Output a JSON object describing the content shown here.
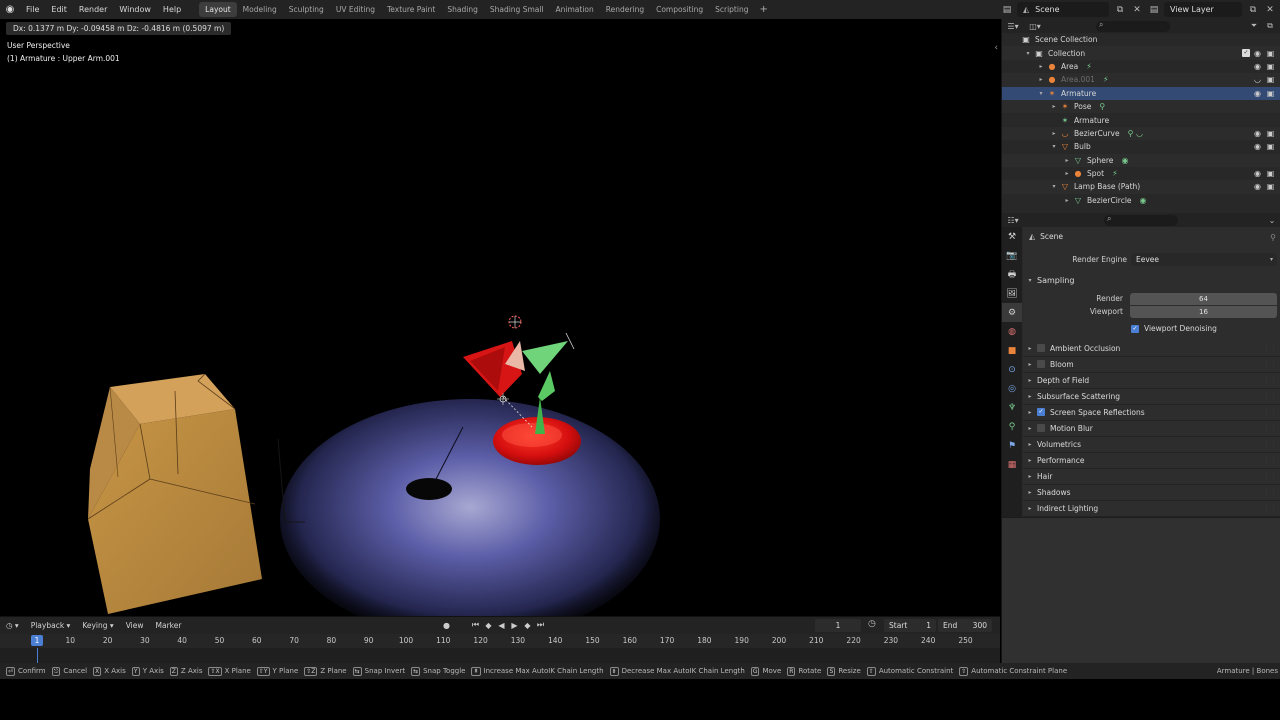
{
  "topbar": {
    "menus": [
      "File",
      "Edit",
      "Render",
      "Window",
      "Help"
    ],
    "workspaces": [
      "Layout",
      "Modeling",
      "Sculpting",
      "UV Editing",
      "Texture Paint",
      "Shading",
      "Shading Small",
      "Animation",
      "Rendering",
      "Compositing",
      "Scripting"
    ],
    "active_workspace": "Layout",
    "add": "+",
    "scene": "Scene",
    "view_layer": "View Layer"
  },
  "viewport": {
    "header_text": "Dx: 0.1377 m  Dy: -0.09458 m  Dz: -0.4816 m (0.5097 m)",
    "view_name": "User Perspective",
    "active_object": "(1) Armature : Upper Arm.001"
  },
  "timeline": {
    "menus": [
      "Playback",
      "Keying",
      "View",
      "Marker"
    ],
    "current_frame": "1",
    "start_label": "Start",
    "start_value": "1",
    "end_label": "End",
    "end_value": "300",
    "ruler": [
      "10",
      "20",
      "30",
      "40",
      "50",
      "60",
      "70",
      "80",
      "90",
      "100",
      "110",
      "120",
      "130",
      "140",
      "150",
      "160",
      "170",
      "180",
      "190",
      "200",
      "210",
      "220",
      "230",
      "240",
      "250"
    ],
    "cursor": "1"
  },
  "statusbar": {
    "items": [
      {
        "key": "⏎",
        "label": "Confirm"
      },
      {
        "key": "⎋",
        "label": "Cancel"
      },
      {
        "key": "X",
        "label": "X Axis"
      },
      {
        "key": "Y",
        "label": "Y Axis"
      },
      {
        "key": "Z",
        "label": "Z Axis"
      },
      {
        "key": "⇧X",
        "label": "X Plane"
      },
      {
        "key": "⇧Y",
        "label": "Y Plane"
      },
      {
        "key": "⇧Z",
        "label": "Z Plane"
      },
      {
        "key": "⇆",
        "label": "Snap Invert"
      },
      {
        "key": "⇆",
        "label": "Snap Toggle"
      },
      {
        "key": "⇞",
        "label": "Increase Max AutoIK Chain Length"
      },
      {
        "key": "⇟",
        "label": "Decrease Max AutoIK Chain Length"
      },
      {
        "key": "G",
        "label": "Move"
      },
      {
        "key": "R",
        "label": "Rotate"
      },
      {
        "key": "S",
        "label": "Resize"
      },
      {
        "key": "⇧",
        "label": "Automatic Constraint"
      },
      {
        "key": "⇧",
        "label": "Automatic Constraint Plane"
      }
    ],
    "right": "Armature | Bones"
  },
  "outliner": {
    "rows": [
      {
        "label": "Scene Collection",
        "indent": 0,
        "twisty": "",
        "icon": "▣",
        "icon_color": "#cfcfcf"
      },
      {
        "label": "Collection",
        "indent": 1,
        "twisty": "▾",
        "icon": "▣",
        "icon_color": "#cfcfcf",
        "check": true
      },
      {
        "label": "Area",
        "indent": 2,
        "twisty": "▸",
        "icon": "●",
        "icon_color": "#e9843a",
        "extra": "⚡",
        "eye": true
      },
      {
        "label": "Area.001",
        "indent": 2,
        "twisty": "▸",
        "icon": "●",
        "icon_color": "#e9843a",
        "dim": true,
        "extra": "⚡",
        "eye": false
      },
      {
        "label": "Armature",
        "indent": 2,
        "twisty": "▾",
        "icon": "✶",
        "icon_color": "#e9843a",
        "selected": true,
        "eye": true
      },
      {
        "label": "Pose",
        "indent": 3,
        "twisty": "▸",
        "icon": "✶",
        "icon_color": "#e9843a",
        "extra": "⚲"
      },
      {
        "label": "Armature",
        "indent": 3,
        "twisty": "",
        "icon": "✶",
        "icon_color": "#79c98d"
      },
      {
        "label": "BezierCurve",
        "indent": 3,
        "twisty": "▸",
        "icon": "◡",
        "icon_color": "#e9843a",
        "extra": "⚲ ◡",
        "eye": true
      },
      {
        "label": "Bulb",
        "indent": 3,
        "twisty": "▾",
        "icon": "▽",
        "icon_color": "#e9843a",
        "eye": true
      },
      {
        "label": "Sphere",
        "indent": 4,
        "twisty": "▸",
        "icon": "▽",
        "icon_color": "#79c98d",
        "extra": "◉"
      },
      {
        "label": "Spot",
        "indent": 4,
        "twisty": "▸",
        "icon": "●",
        "icon_color": "#e9843a",
        "extra": "⚡",
        "eye": true
      },
      {
        "label": "Lamp Base (Path)",
        "indent": 3,
        "twisty": "▾",
        "icon": "▽",
        "icon_color": "#e9843a",
        "eye": true
      },
      {
        "label": "BezierCircle",
        "indent": 4,
        "twisty": "▸",
        "icon": "▽",
        "icon_color": "#79c98d",
        "extra": "◉"
      }
    ]
  },
  "properties": {
    "context": "Scene",
    "render_engine_label": "Render Engine",
    "render_engine_value": "Eevee",
    "sampling_label": "Sampling",
    "render_label": "Render",
    "render_value": "64",
    "viewport_label": "Viewport",
    "viewport_value": "16",
    "viewport_denoising": "Viewport Denoising",
    "panels": [
      {
        "label": "Ambient Occlusion",
        "checkbox": "off"
      },
      {
        "label": "Bloom",
        "checkbox": "off"
      },
      {
        "label": "Depth of Field",
        "checkbox": "none"
      },
      {
        "label": "Subsurface Scattering",
        "checkbox": "none"
      },
      {
        "label": "Screen Space Reflections",
        "checkbox": "on"
      },
      {
        "label": "Motion Blur",
        "checkbox": "off"
      },
      {
        "label": "Volumetrics",
        "checkbox": "none"
      },
      {
        "label": "Performance",
        "checkbox": "none"
      },
      {
        "label": "Hair",
        "checkbox": "none"
      },
      {
        "label": "Shadows",
        "checkbox": "none"
      },
      {
        "label": "Indirect Lighting",
        "checkbox": "none"
      }
    ],
    "tabs": [
      {
        "icon": "⚒",
        "color": "#cfcfcf"
      },
      {
        "icon": "📷",
        "color": "#cfcfcf"
      },
      {
        "icon": "🖶",
        "color": "#cfcfcf"
      },
      {
        "icon": "🖼",
        "color": "#cfcfcf"
      },
      {
        "icon": "⚙",
        "color": "#cfcfcf"
      },
      {
        "icon": "◍",
        "color": "#e07373"
      },
      {
        "icon": "■",
        "color": "#e9843a"
      },
      {
        "icon": "⊙",
        "color": "#7aa7e6"
      },
      {
        "icon": "◎",
        "color": "#7aa7e6"
      },
      {
        "icon": "♆",
        "color": "#79c98d"
      },
      {
        "icon": "⚲",
        "color": "#79c98d"
      },
      {
        "icon": "⚑",
        "color": "#7aa7e6"
      },
      {
        "icon": "▦",
        "color": "#e07373"
      }
    ]
  }
}
